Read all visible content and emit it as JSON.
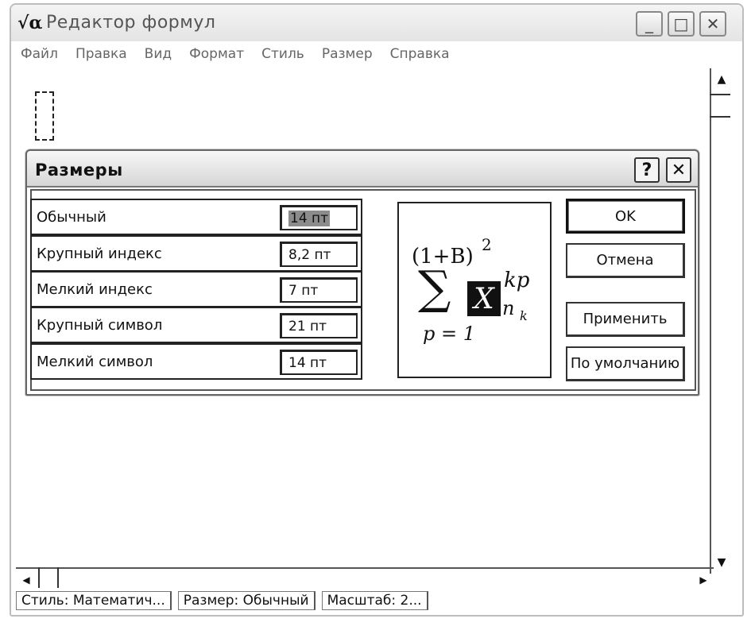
{
  "window": {
    "title": "Редактор формул",
    "icon": "sqrt-alpha-icon",
    "icon_glyph": "√α",
    "controls": {
      "minimize": "_",
      "maximize": "□",
      "close": "✕"
    }
  },
  "menu": [
    "Файл",
    "Правка",
    "Вид",
    "Формат",
    "Стиль",
    "Размер",
    "Справка"
  ],
  "dialog": {
    "title": "Размеры",
    "help_glyph": "?",
    "close_glyph": "✕",
    "rows": [
      {
        "label": "Обычный",
        "value": "14 пт"
      },
      {
        "label": "Крупный индекс",
        "value": "8,2 пт"
      },
      {
        "label": "Мелкий индекс",
        "value": "7 пт"
      },
      {
        "label": "Крупный символ",
        "value": "21 пт"
      },
      {
        "label": "Мелкий символ",
        "value": "14 пт"
      }
    ],
    "buttons": {
      "ok": "OK",
      "cancel": "Отмена",
      "apply": "Применить",
      "default": "По умолчанию"
    },
    "preview": {
      "top": "(1+B)",
      "top_exp": "2",
      "sum": "∑",
      "var": "X",
      "sup": "kp",
      "sub": "n",
      "sub_sub": "k",
      "lower": "p = 1"
    }
  },
  "status": [
    "Стиль: Математич...",
    "Размер: Обычный",
    "Масштаб: 2..."
  ],
  "scroll": {
    "up": "▲",
    "down": "▼",
    "left": "◀",
    "right": "▶"
  }
}
